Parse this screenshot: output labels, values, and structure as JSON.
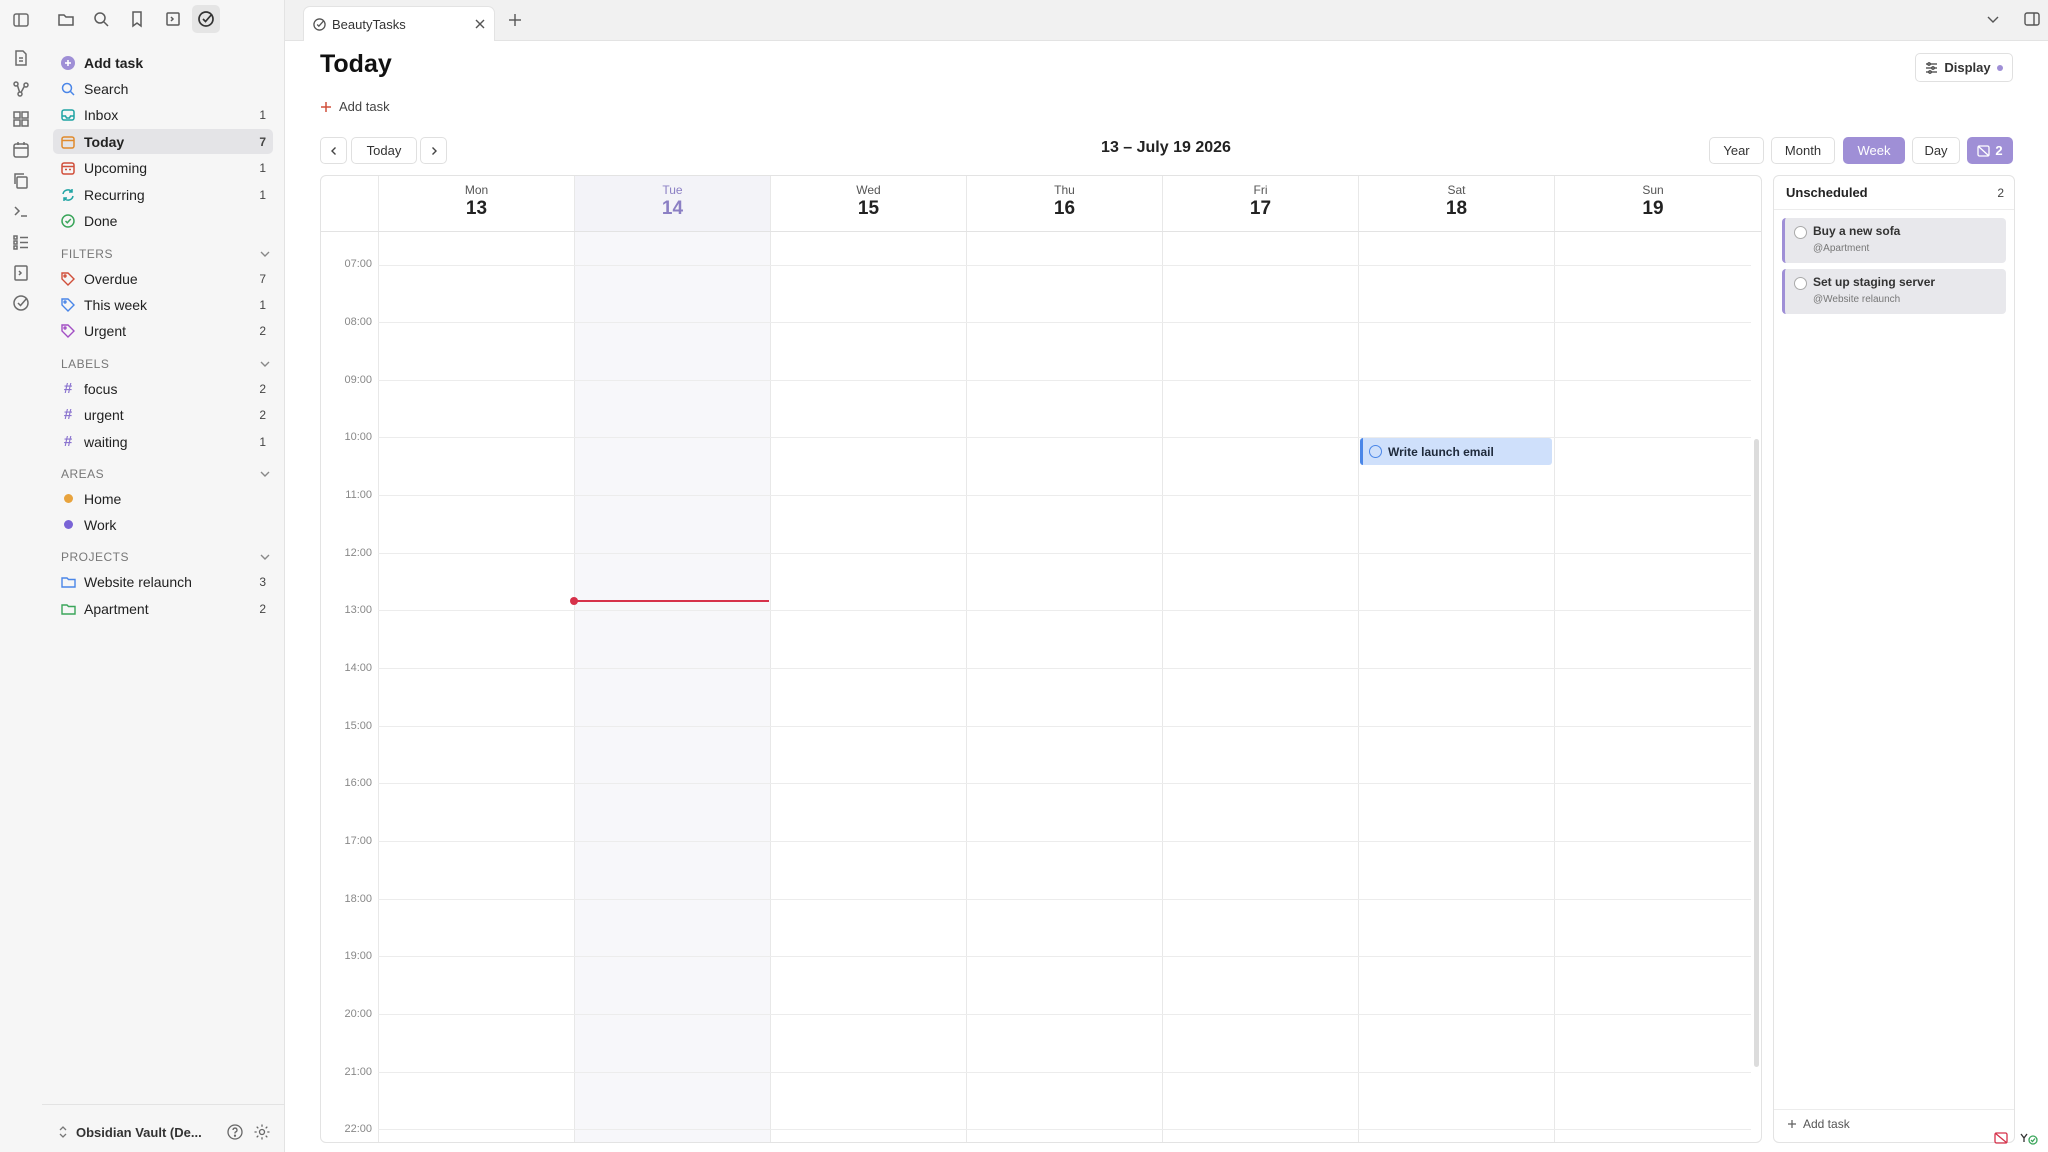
{
  "sidebar": {
    "add_task": "Add task",
    "search": "Search",
    "nav": [
      {
        "label": "Inbox",
        "count": "1"
      },
      {
        "label": "Today",
        "count": "7"
      },
      {
        "label": "Upcoming",
        "count": "1"
      },
      {
        "label": "Recurring",
        "count": "1"
      },
      {
        "label": "Done",
        "count": ""
      }
    ],
    "filters_header": "FILTERS",
    "filters": [
      {
        "label": "Overdue",
        "count": "7"
      },
      {
        "label": "This week",
        "count": "1"
      },
      {
        "label": "Urgent",
        "count": "2"
      }
    ],
    "labels_header": "LABELS",
    "labels": [
      {
        "label": "focus",
        "count": "2"
      },
      {
        "label": "urgent",
        "count": "2"
      },
      {
        "label": "waiting",
        "count": "1"
      }
    ],
    "areas_header": "AREAS",
    "areas": [
      {
        "label": "Home",
        "color": "#e8a33d"
      },
      {
        "label": "Work",
        "color": "#7a64d6"
      }
    ],
    "projects_header": "PROJECTS",
    "projects": [
      {
        "label": "Website relaunch",
        "count": "3"
      },
      {
        "label": "Apartment",
        "count": "2"
      }
    ],
    "vault": "Obsidian Vault (De..."
  },
  "tab": {
    "title": "BeautyTasks"
  },
  "main": {
    "title": "Today",
    "add_task": "Add task",
    "display": "Display",
    "today_btn": "Today",
    "range": "13 – July 19 2026",
    "views": [
      "Year",
      "Month",
      "Week",
      "Day"
    ],
    "unscheduled_toggle": "2"
  },
  "calendar": {
    "days": [
      {
        "name": "Mon",
        "date": "13"
      },
      {
        "name": "Tue",
        "date": "14"
      },
      {
        "name": "Wed",
        "date": "15"
      },
      {
        "name": "Thu",
        "date": "16"
      },
      {
        "name": "Fri",
        "date": "17"
      },
      {
        "name": "Sat",
        "date": "18"
      },
      {
        "name": "Sun",
        "date": "19"
      }
    ],
    "hours": [
      "07:00",
      "08:00",
      "09:00",
      "10:00",
      "11:00",
      "12:00",
      "13:00",
      "14:00",
      "15:00",
      "16:00",
      "17:00",
      "18:00",
      "19:00",
      "20:00",
      "21:00",
      "22:00"
    ],
    "event": {
      "title": "Write launch email",
      "day": "Sat",
      "start": "10:00"
    }
  },
  "unscheduled": {
    "title": "Unscheduled",
    "count": "2",
    "items": [
      {
        "title": "Buy a new sofa",
        "project": "@Apartment"
      },
      {
        "title": "Set up staging server",
        "project": "@Website relaunch"
      }
    ],
    "add_task": "Add task"
  },
  "colors": {
    "accent": "#9f8fd6",
    "now_line": "#d6314a",
    "event_bg": "#cfe0fb"
  }
}
